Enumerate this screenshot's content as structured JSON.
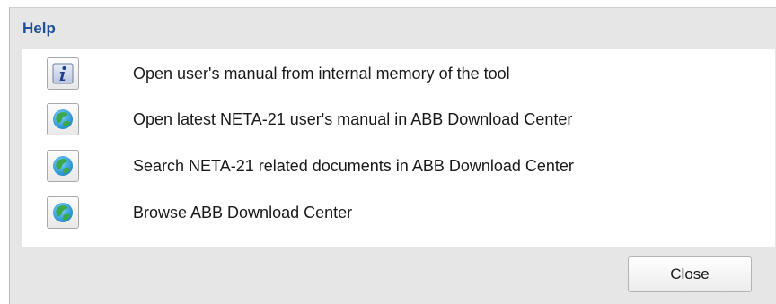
{
  "dialog": {
    "title": "Help",
    "title_color": "#1f4f9a",
    "items": [
      {
        "icon": "info-icon",
        "label": "Open user's manual from internal memory of the tool"
      },
      {
        "icon": "globe-icon",
        "label": "Open latest NETA-21 user's manual in ABB Download Center"
      },
      {
        "icon": "globe-icon",
        "label": "Search NETA-21 related documents in ABB Download Center"
      },
      {
        "icon": "globe-icon",
        "label": "Browse ABB Download Center"
      }
    ],
    "close_label": "Close"
  }
}
